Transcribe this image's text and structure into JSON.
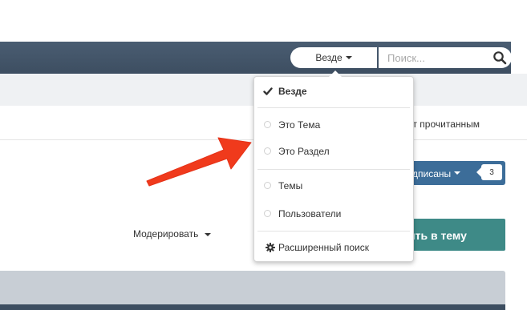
{
  "header": {
    "scope_selected": "Везде",
    "search_placeholder": "Поиск..."
  },
  "toolbar": {
    "mark_read_label": "ть сайт прочитанным",
    "subscribe_label": "дписаны",
    "subscriber_count": "3",
    "moderate_label": "Модерировать",
    "reply_label": "ить в тему"
  },
  "dropdown": {
    "items": [
      {
        "label": "Везде",
        "selected": true
      },
      {
        "label": "Это Тема",
        "selected": false
      },
      {
        "label": "Это Раздел",
        "selected": false
      },
      {
        "label": "Темы",
        "selected": false
      },
      {
        "label": "Пользователи",
        "selected": false
      },
      {
        "label": "Расширенный поиск",
        "icon": "gear-icon"
      }
    ]
  },
  "colors": {
    "topbar": "#45576b",
    "subscribe": "#3c6d99",
    "reply": "#3e8a87",
    "arrow": "#f03a1c"
  },
  "icons": {
    "search": "search-icon",
    "check": "check-icon",
    "gear": "gear-icon",
    "arrow": "red-arrow-annotation"
  }
}
